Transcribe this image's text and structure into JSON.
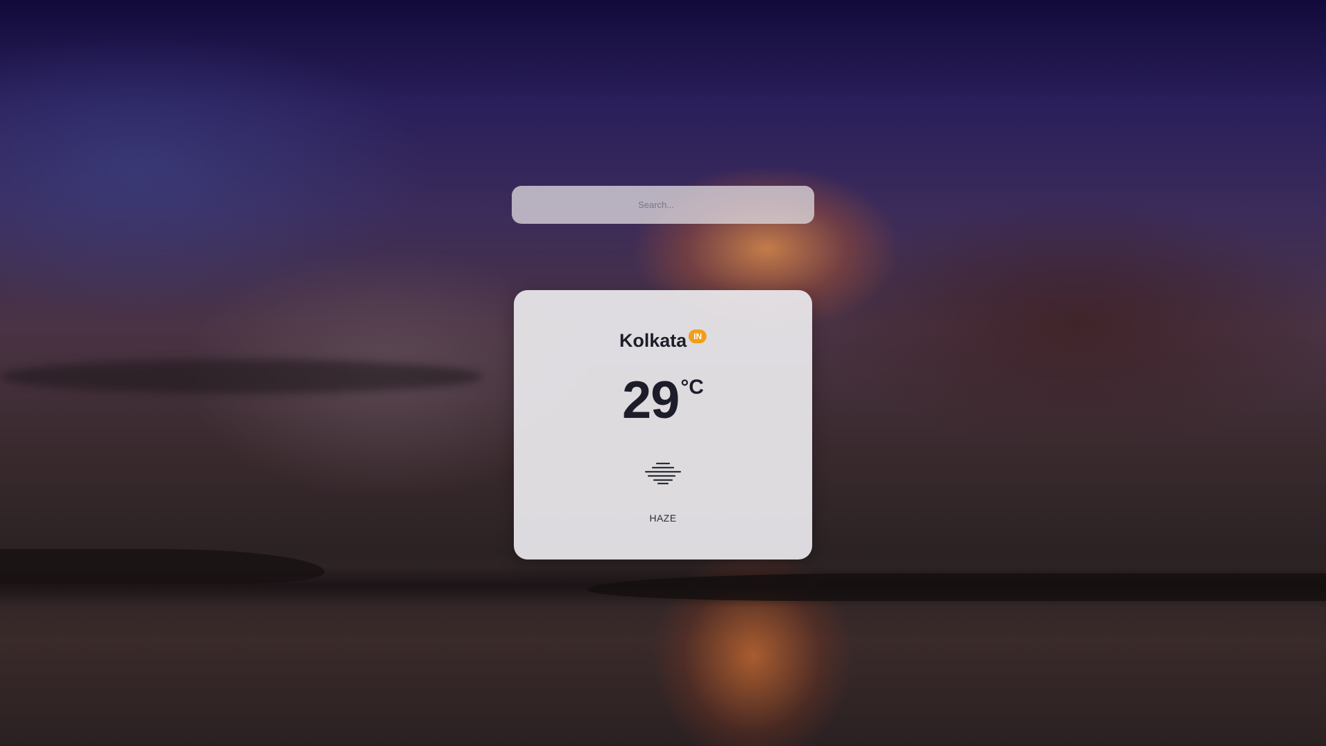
{
  "search": {
    "placeholder": "Search...",
    "value": ""
  },
  "weather": {
    "city": "Kolkata",
    "country_code": "IN",
    "temperature": "29",
    "unit": "°C",
    "condition": "HAZE",
    "icon": "haze-icon"
  },
  "colors": {
    "badge": "#f29e1a",
    "text": "#1d1d2a",
    "card_bg": "#eceaee"
  }
}
